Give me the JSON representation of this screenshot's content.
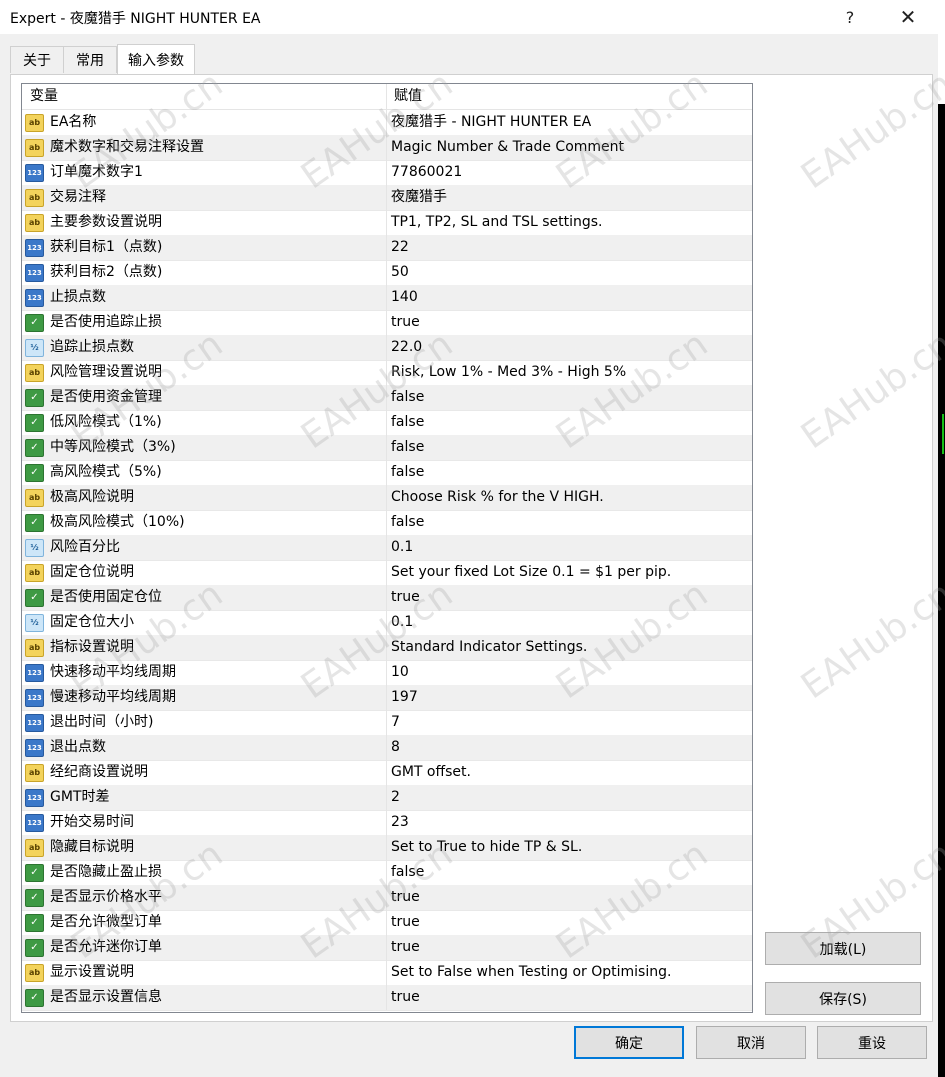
{
  "window": {
    "title": "Expert - 夜魔猎手 NIGHT HUNTER EA",
    "help_label": "?",
    "close_label": "✕"
  },
  "tabs": [
    {
      "label": "关于"
    },
    {
      "label": "常用"
    },
    {
      "label": "输入参数"
    }
  ],
  "table": {
    "headers": {
      "variable": "变量",
      "value": "赋值"
    },
    "rows": [
      {
        "type": "ab",
        "name": "EA名称",
        "value": " 夜魔猎手 - NIGHT HUNTER EA"
      },
      {
        "type": "ab",
        "name": "魔术数字和交易注释设置",
        "value": "Magic Number & Trade Comment"
      },
      {
        "type": "123",
        "name": "订单魔术数字1",
        "value": "77860021"
      },
      {
        "type": "ab",
        "name": "交易注释",
        "value": "夜魔猎手"
      },
      {
        "type": "ab",
        "name": "主要参数设置说明",
        "value": "TP1, TP2, SL and TSL settings."
      },
      {
        "type": "123",
        "name": "获利目标1（点数)",
        "value": "22"
      },
      {
        "type": "123",
        "name": "获利目标2（点数)",
        "value": "50"
      },
      {
        "type": "123",
        "name": "止损点数",
        "value": "140"
      },
      {
        "type": "bool",
        "name": "是否使用追踪止损",
        "value": "true"
      },
      {
        "type": "dbl",
        "name": "追踪止损点数",
        "value": "22.0"
      },
      {
        "type": "ab",
        "name": "风险管理设置说明",
        "value": "Risk, Low 1% - Med 3% - High 5%"
      },
      {
        "type": "bool",
        "name": "是否使用资金管理",
        "value": "false"
      },
      {
        "type": "bool",
        "name": "低风险模式（1%)",
        "value": "false"
      },
      {
        "type": "bool",
        "name": "中等风险模式（3%)",
        "value": "false"
      },
      {
        "type": "bool",
        "name": "高风险模式（5%)",
        "value": "false"
      },
      {
        "type": "ab",
        "name": "极高风险说明",
        "value": "Choose Risk % for the V HIGH."
      },
      {
        "type": "bool",
        "name": "极高风险模式（10%)",
        "value": "false"
      },
      {
        "type": "dbl",
        "name": "风险百分比",
        "value": "0.1"
      },
      {
        "type": "ab",
        "name": "固定仓位说明",
        "value": "Set your fixed Lot Size 0.1 = $1 per pip."
      },
      {
        "type": "bool",
        "name": "是否使用固定仓位",
        "value": "true"
      },
      {
        "type": "dbl",
        "name": "固定仓位大小",
        "value": "0.1"
      },
      {
        "type": "ab",
        "name": "指标设置说明",
        "value": "Standard Indicator Settings."
      },
      {
        "type": "123",
        "name": "快速移动平均线周期",
        "value": "10"
      },
      {
        "type": "123",
        "name": "慢速移动平均线周期",
        "value": "197"
      },
      {
        "type": "123",
        "name": "退出时间（小时)",
        "value": "7"
      },
      {
        "type": "123",
        "name": "退出点数",
        "value": "8"
      },
      {
        "type": "ab",
        "name": "经纪商设置说明",
        "value": "GMT offset."
      },
      {
        "type": "123",
        "name": "GMT时差",
        "value": "2"
      },
      {
        "type": "123",
        "name": "开始交易时间",
        "value": "23"
      },
      {
        "type": "ab",
        "name": "隐藏目标说明",
        "value": "Set to True to hide TP & SL."
      },
      {
        "type": "bool",
        "name": "是否隐藏止盈止损",
        "value": "false"
      },
      {
        "type": "bool",
        "name": "是否显示价格水平",
        "value": "true"
      },
      {
        "type": "bool",
        "name": "是否允许微型订单",
        "value": "true"
      },
      {
        "type": "bool",
        "name": "是否允许迷你订单",
        "value": "true"
      },
      {
        "type": "ab",
        "name": "显示设置说明",
        "value": "Set to False when Testing or Optimising."
      },
      {
        "type": "bool",
        "name": "是否显示设置信息",
        "value": "true"
      }
    ]
  },
  "icon_glyphs": {
    "ab": "ab",
    "123": "123",
    "bool": "✓",
    "dbl": "½"
  },
  "buttons": {
    "load": "加载(L)",
    "save": "保存(S)",
    "ok": "确定",
    "cancel": "取消",
    "reset": "重设"
  },
  "watermark": "EAHub.cn",
  "colors": {
    "selected_border": "#0078d7",
    "row_alt": "#f0f0f0",
    "icon_string": "#f3d35c",
    "icon_int": "#3b78c9",
    "icon_bool": "#3e9a44",
    "icon_double": "#cde6f8"
  }
}
